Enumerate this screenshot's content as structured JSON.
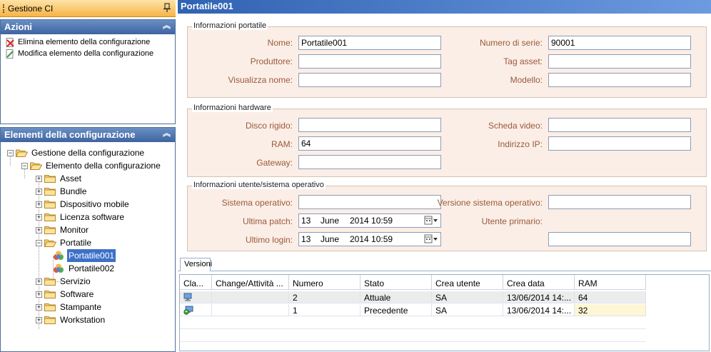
{
  "left_pane": {
    "title": "Gestione CI",
    "pin_icon": "pin-icon"
  },
  "actions_panel": {
    "title": "Azioni",
    "items": [
      {
        "label": "Elimina elemento della configurazione",
        "icon": "delete-icon"
      },
      {
        "label": "Modifica elemento della configurazione",
        "icon": "edit-icon"
      }
    ]
  },
  "elements_panel": {
    "title": "Elementi della configurazione",
    "tree": [
      {
        "label": "Gestione della configurazione",
        "level": 0,
        "expanded": true
      },
      {
        "label": "Elemento della configurazione",
        "level": 1,
        "expanded": true
      },
      {
        "label": "Asset",
        "level": 2,
        "expanded": false
      },
      {
        "label": "Bundle",
        "level": 2,
        "expanded": false
      },
      {
        "label": "Dispositivo mobile",
        "level": 2,
        "expanded": false
      },
      {
        "label": "Licenza software",
        "level": 2,
        "expanded": false
      },
      {
        "label": "Monitor",
        "level": 2,
        "expanded": false
      },
      {
        "label": "Portatile",
        "level": 2,
        "expanded": true
      },
      {
        "label": "Portatile001",
        "level": 3,
        "selected": true
      },
      {
        "label": "Portatile002",
        "level": 3
      },
      {
        "label": "Servizio",
        "level": 2,
        "expanded": false
      },
      {
        "label": "Software",
        "level": 2,
        "expanded": false
      },
      {
        "label": "Stampante",
        "level": 2,
        "expanded": false
      },
      {
        "label": "Workstation",
        "level": 2,
        "expanded": false
      }
    ]
  },
  "header": {
    "title": "Portatile001"
  },
  "portable_info": {
    "title": "Informazioni portatile",
    "nome_label": "Nome:",
    "nome_value": "Portatile001",
    "serie_label": "Numero di serie:",
    "serie_value": "90001",
    "produttore_label": "Produttore:",
    "produttore_value": "",
    "tag_label": "Tag asset:",
    "tag_value": "",
    "visualizza_label": "Visualizza nome:",
    "visualizza_value": "",
    "modello_label": "Modello:",
    "modello_value": ""
  },
  "hardware_info": {
    "title": "Informazioni hardware",
    "disco_label": "Disco rigido:",
    "disco_value": "",
    "scheda_label": "Scheda video:",
    "scheda_value": "",
    "ram_label": "RAM:",
    "ram_value": "64",
    "ip_label": "Indirizzo IP:",
    "ip_value": "",
    "gateway_label": "Gateway:",
    "gateway_value": ""
  },
  "os_info": {
    "title": "Informazioni utente/sistema operativo",
    "so_label": "Sistema operativo:",
    "so_value": "",
    "versione_label": "Versione sistema operativo:",
    "versione_value": "",
    "patch_label": "Ultima patch:",
    "patch_day": "13",
    "patch_month": "June",
    "patch_rest": "2014 10:59",
    "utente_label": "Utente primario:",
    "utente_value": "",
    "login_label": "Ultimo login:",
    "login_day": "13",
    "login_month": "June",
    "login_rest": "2014 10:59"
  },
  "versions": {
    "tab_label": "Versioni",
    "columns": [
      "Cla...",
      "Change/Attività ...",
      "Numero",
      "Stato",
      "Crea utente",
      "Crea data",
      "RAM"
    ],
    "rows": [
      {
        "icon": "computer-icon",
        "change": "",
        "numero": "2",
        "stato": "Attuale",
        "utente": "SA",
        "data": "13/06/2014 14:...",
        "ram": "64"
      },
      {
        "icon": "computer-refresh-icon",
        "change": "",
        "numero": "1",
        "stato": "Precedente",
        "utente": "SA",
        "data": "13/06/2014 14:...",
        "ram": "32"
      }
    ]
  }
}
